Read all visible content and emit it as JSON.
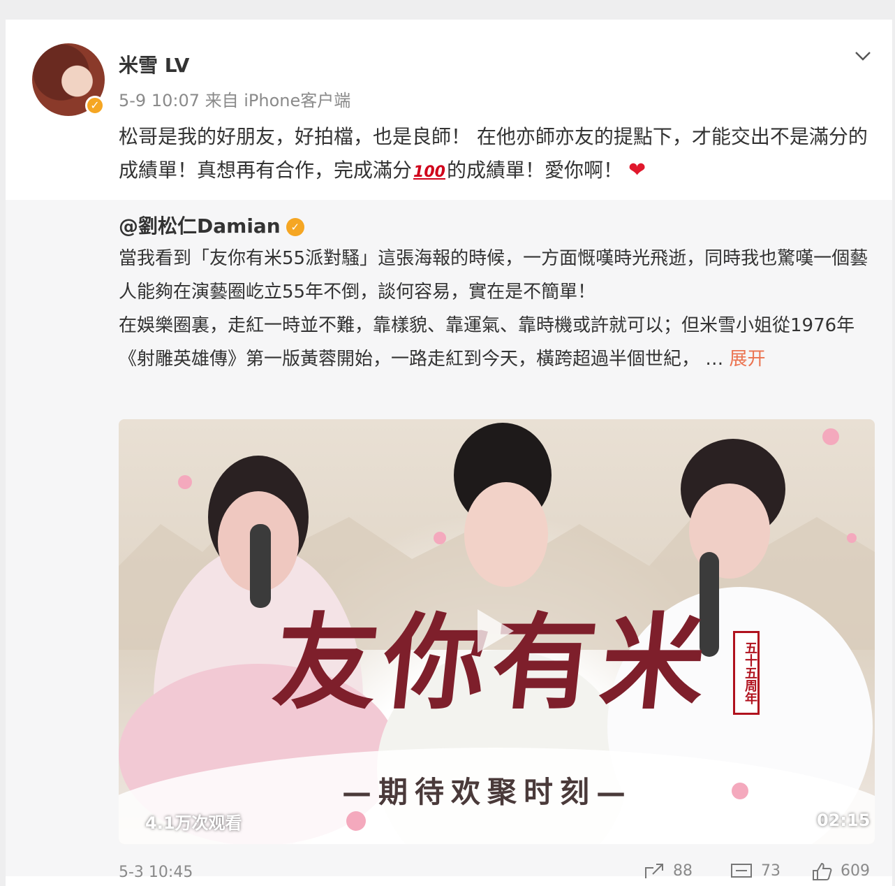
{
  "post": {
    "username": "米雪",
    "level_badge": "LV",
    "timestamp": "5-9 10:07",
    "source": "来自 iPhone客户端",
    "text_part1": "松哥是我的好朋友，好拍檔，也是良師！ 在他亦師亦友的提點下，才能交出不是滿分的成績單！真想再有合作，完成滿分",
    "emoji_100": "100",
    "text_part2": "的成績單！愛你啊！",
    "heart": "❤"
  },
  "quoted": {
    "author": "@劉松仁Damian",
    "line1": "當我看到「友你有米55派對騷」這張海報的時候，一方面慨嘆時光飛逝，同時我也驚嘆一個藝人能夠在演藝圈屹立55年不倒，談何容易，實在是不簡單！",
    "line2": "在娛樂圈裏，走紅一時並不難，靠樣貌、靠運氣、靠時機或許就可以；但米雪小姐從1976年《射雕英雄傳》第一版黃蓉開始，一路走紅到今天，橫跨超過半個世紀，",
    "ellipsis": "…",
    "expand_label": "展开",
    "video": {
      "title_art": "友你有米",
      "subtitle": "—期待欢聚时刻—",
      "stamp": "五十五周年",
      "views": "4.1万次观看",
      "duration": "02:15"
    },
    "footer_time": "5-3 10:45",
    "repost_count": "88",
    "comment_count": "73",
    "like_count": "609"
  },
  "colors": {
    "accent": "#eb7350",
    "verified": "#f5a623",
    "title_red": "#7e1f2b"
  }
}
